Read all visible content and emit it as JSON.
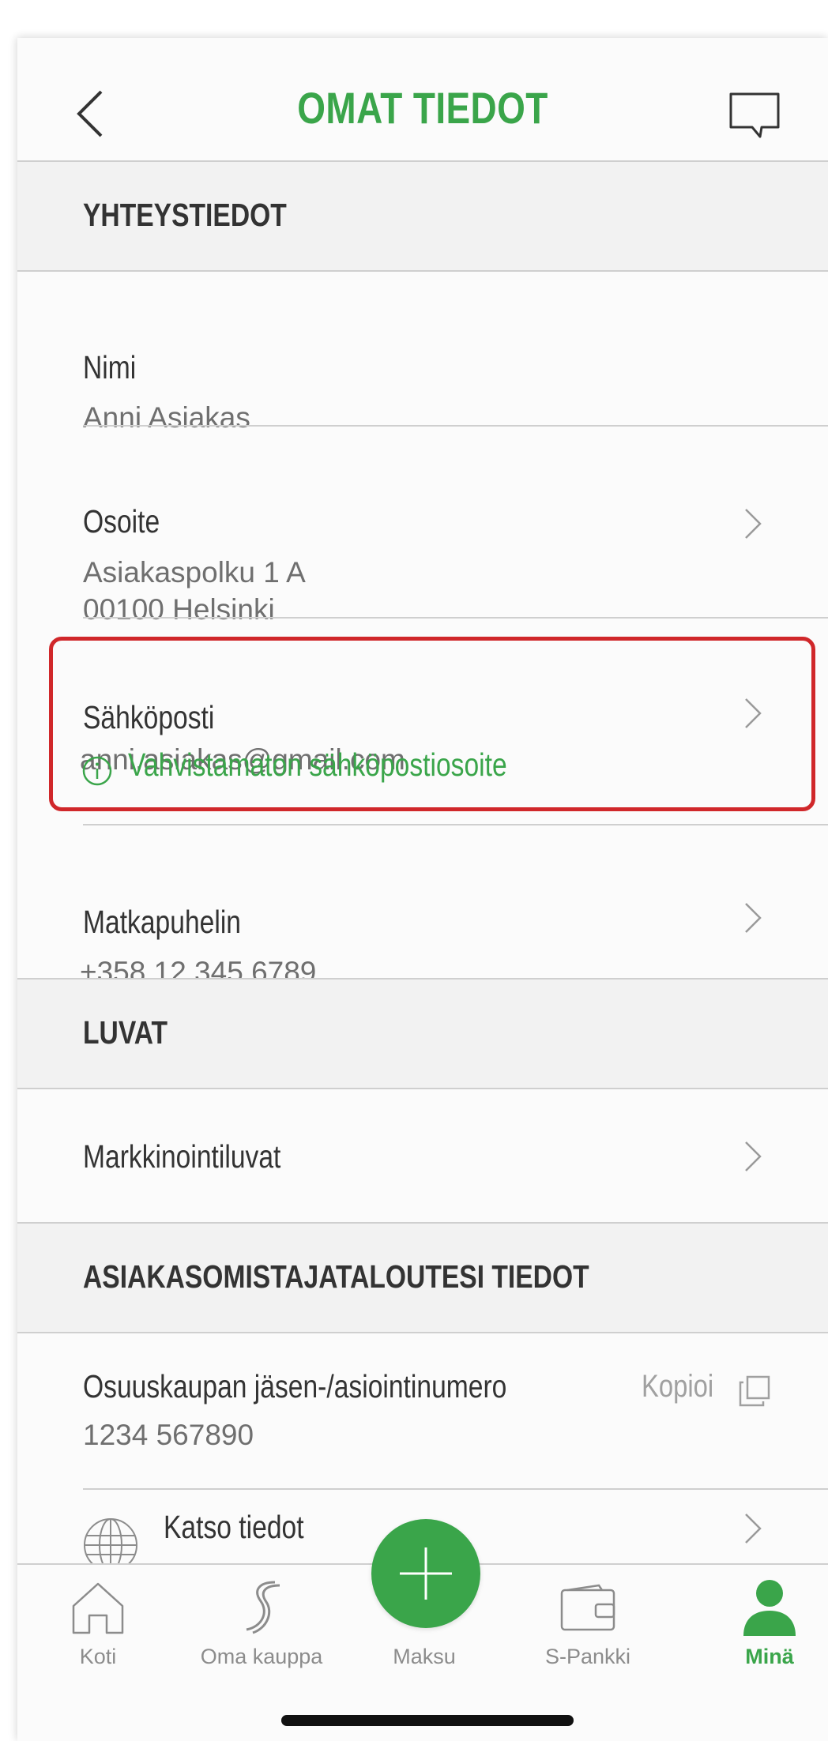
{
  "header": {
    "title": "OMAT TIEDOT",
    "back_icon": "chevron-left-icon",
    "chat_icon": "chat-bubble-icon"
  },
  "sections": {
    "contact": "YHTEYSTIEDOT",
    "permissions": "LUVAT",
    "household": "ASIAKASOMISTAJATALOUTESI TIEDOT"
  },
  "contact": {
    "name_label": "Nimi",
    "name_value": "Anni Asiakas",
    "address_label": "Osoite",
    "address_line1": "Asiakaspolku 1 A",
    "address_line2": "00100 Helsinki",
    "email_label": "Sähköposti",
    "email_value": "anni.asiakas@gmail.com",
    "email_warning": "Vahvistamaton sähköpostiosoite",
    "phone_label": "Matkapuhelin",
    "phone_value": "+358 12 345 6789"
  },
  "permissions": {
    "marketing_label": "Markkinointiluvat"
  },
  "household": {
    "member_label": "Osuuskaupan jäsen-/asiointinumero",
    "member_value": "1234 567890",
    "copy_label": "Kopioi",
    "details_label": "Katso tiedot"
  },
  "tabs": [
    {
      "label": "Koti",
      "icon": "home-icon"
    },
    {
      "label": "Oma kauppa",
      "icon": "s-logo-icon"
    },
    {
      "label": "Maksu",
      "icon": "plus-icon"
    },
    {
      "label": "S-Pankki",
      "icon": "wallet-icon"
    },
    {
      "label": "Minä",
      "icon": "person-icon"
    }
  ],
  "colors": {
    "accent": "#3aa54a",
    "highlight": "#d0272a",
    "text": "#333333",
    "muted": "#6f6f6f"
  }
}
